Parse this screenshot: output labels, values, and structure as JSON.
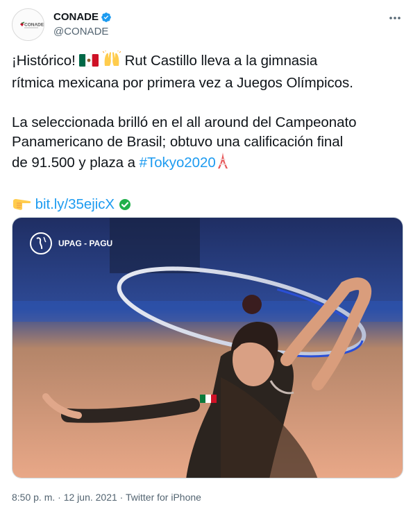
{
  "author": {
    "display_name": "CONADE",
    "handle": "@CONADE",
    "avatar_label": "CONADE",
    "avatar_icon": "conade-logo-icon",
    "verified_icon": "verified-badge-icon"
  },
  "more_icon": "more-options-icon",
  "tweet": {
    "line1_pre": "¡Histórico! ",
    "line1_post": " Rut Castillo lleva a la gimnasia",
    "line2": "rítmica mexicana por primera vez a Juegos Olímpicos.",
    "p2_line1": "La seleccionada brilló en el all around del Campeonato",
    "p2_line2": "Panamericano de Brasil; obtuvo una calificación final",
    "p2_line3_pre": "de 91.500 y plaza a ",
    "hashtag": "#Tokyo2020",
    "link_text": "bit.ly/35ejicX"
  },
  "emojis": {
    "flag": "mexico-flag-icon",
    "hands": "raising-hands-icon",
    "tower": "tokyo-tower-icon",
    "pointing": "pointing-right-icon",
    "check": "green-check-icon"
  },
  "media": {
    "watermark": "UPAG - PAGU",
    "watermark_icon": "upag-globe-icon"
  },
  "footer": {
    "time": "8:50 p. m.",
    "separator1": " · ",
    "date": "12 jun. 2021",
    "separator2": " · ",
    "source": "Twitter for iPhone"
  },
  "colors": {
    "link": "#1d9bf0",
    "secondary_text": "#536471",
    "verified": "#1d9bf0"
  }
}
